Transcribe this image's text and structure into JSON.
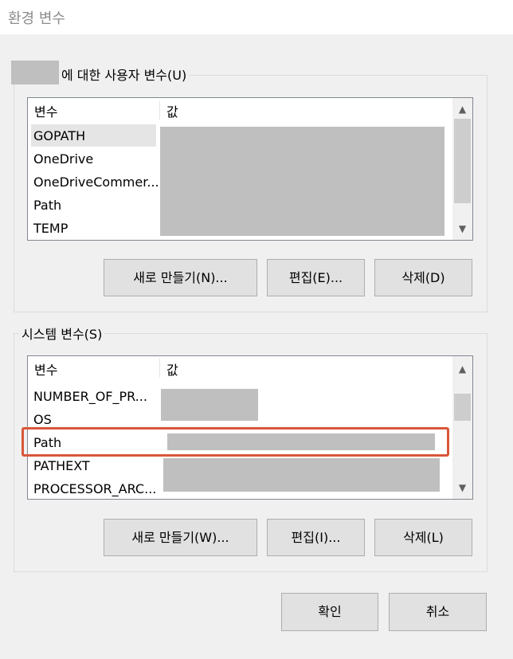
{
  "window": {
    "title": "환경 변수"
  },
  "user_section": {
    "legend": "에 대한 사용자 변수(U)",
    "columns": {
      "name": "변수",
      "value": "값"
    },
    "rows": [
      {
        "name": "GOPATH"
      },
      {
        "name": "OneDrive"
      },
      {
        "name": "OneDriveCommer..."
      },
      {
        "name": "Path"
      },
      {
        "name": "TEMP"
      }
    ],
    "buttons": {
      "new": "새로 만들기(N)...",
      "edit": "편집(E)...",
      "delete": "삭제(D)"
    }
  },
  "system_section": {
    "legend": "시스템 변수(S)",
    "columns": {
      "name": "변수",
      "value": "값"
    },
    "rows": [
      {
        "name": "NUMBER_OF_PR..."
      },
      {
        "name": "OS"
      },
      {
        "name": "Path"
      },
      {
        "name": "PATHEXT"
      },
      {
        "name": "PROCESSOR_ARC..."
      }
    ],
    "buttons": {
      "new": "새로 만들기(W)...",
      "edit": "편집(I)...",
      "delete": "삭제(L)"
    }
  },
  "dialog_buttons": {
    "ok": "확인",
    "cancel": "취소"
  },
  "colors": {
    "highlight": "#d9573a",
    "redaction": "#bfbfbf"
  }
}
